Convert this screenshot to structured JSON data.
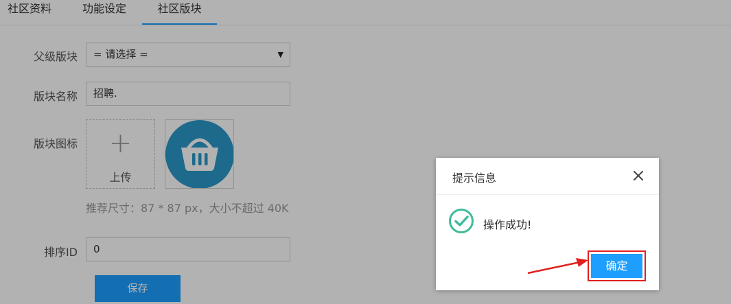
{
  "tabs": [
    {
      "label": "社区资料"
    },
    {
      "label": "功能设定"
    },
    {
      "label": "社区版块"
    }
  ],
  "form": {
    "parent_label": "父级版块",
    "parent_value": "= 请选择 =",
    "name_label": "版块名称",
    "name_value": "招聘.",
    "icon_label": "版块图标",
    "upload_label": "上传",
    "hint": "推荐尺寸：87 * 87 px，大小不超过 40K",
    "sort_label": "排序ID",
    "sort_value": "0",
    "save_label": "保存"
  },
  "dialog": {
    "title": "提示信息",
    "message": "操作成功!",
    "ok_label": "确定"
  },
  "colors": {
    "accent": "#1e9fff",
    "success": "#3dbb9a",
    "basket": "#2a99c9",
    "annotation": "#e02020"
  },
  "icons": [
    "plus-icon",
    "basket-icon",
    "close-icon",
    "success-check-icon",
    "caret-down-icon"
  ]
}
